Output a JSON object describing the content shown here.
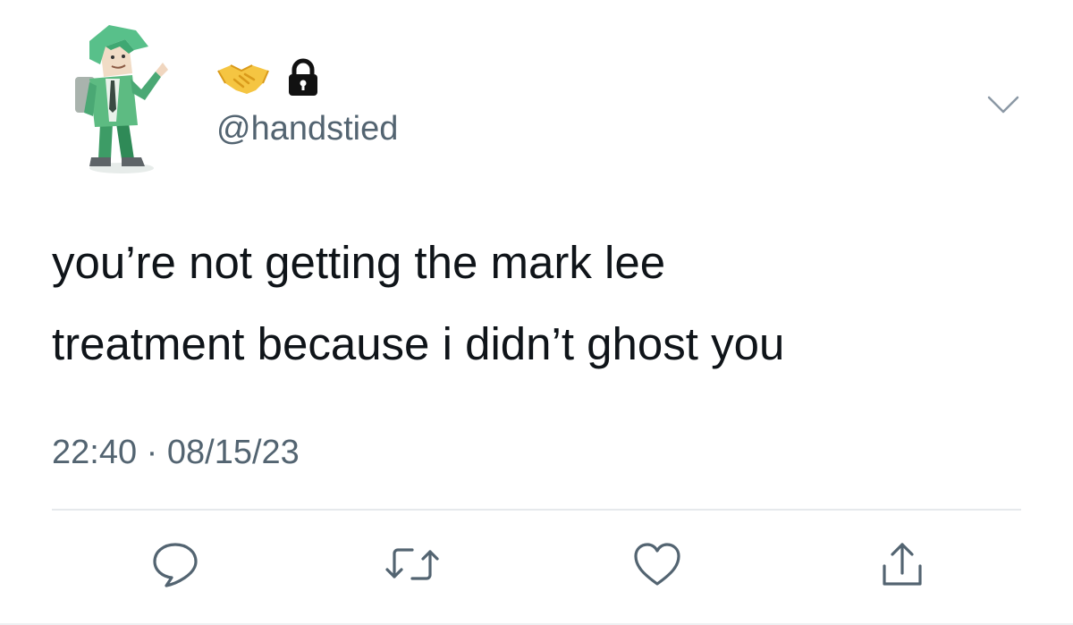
{
  "author": {
    "display_name_icons": [
      "handshake-icon",
      "lock-icon"
    ],
    "handle": "@handstied"
  },
  "tweet": {
    "text_lines": [
      "you’re not getting the mark lee",
      "treatment because i didn’t ghost you"
    ],
    "time": "22:40",
    "separator": "·",
    "date": "08/15/23"
  },
  "actions": [
    {
      "name": "reply",
      "icon": "speech-bubble-icon"
    },
    {
      "name": "retweet",
      "icon": "retweet-icon"
    },
    {
      "name": "like",
      "icon": "heart-icon"
    },
    {
      "name": "share",
      "icon": "share-icon"
    }
  ],
  "colors": {
    "text": "#0f1419",
    "secondary": "#536471",
    "divider": "#e6e9ec",
    "avatar_green": "#4caf7a",
    "handshake_yellow": "#f5c542"
  }
}
